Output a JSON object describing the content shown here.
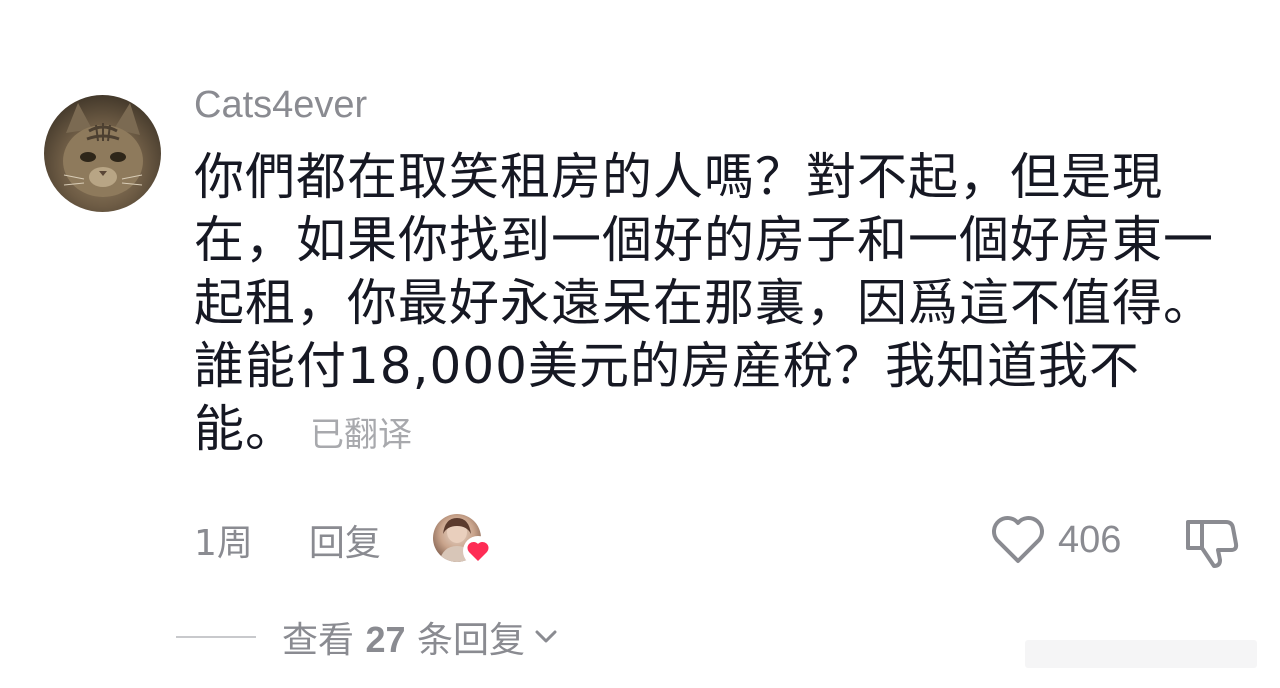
{
  "comment": {
    "username": "Cats4ever",
    "text": "你們都在取笑租房的人嗎？對不起，但是現在，如果你找到一個好的房子和一個好房東一起租，你最好永遠呆在那裏，因爲這不值得。誰能付18,000美元的房産稅？我知道我不能。",
    "translated_label": "已翻译",
    "time": "1周",
    "reply_label": "回复",
    "like_count": "406",
    "liked_by_creator": true,
    "avatar_icon": "cat-avatar",
    "creator_avatar_icon": "creator-avatar"
  },
  "replies": {
    "prefix": "查看",
    "count": "27",
    "suffix": "条回复"
  },
  "colors": {
    "primary_text": "#161823",
    "secondary_text": "#8a8b91",
    "creator_heart": "#fe2c55"
  }
}
